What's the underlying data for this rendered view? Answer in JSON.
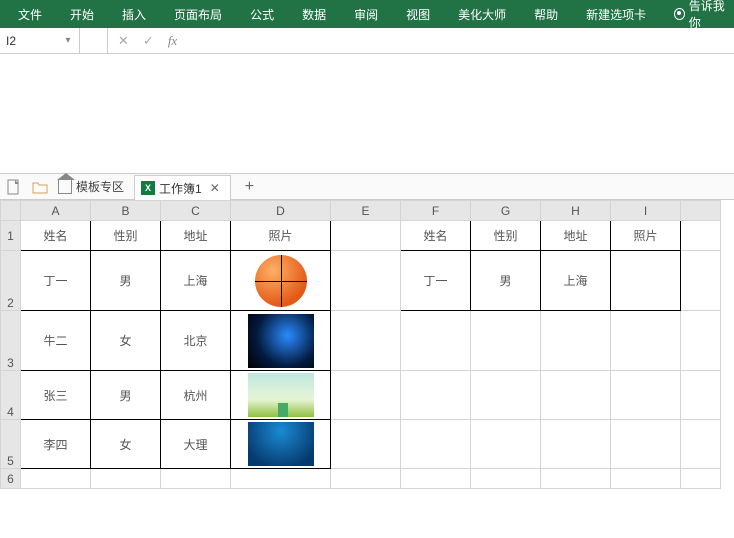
{
  "ribbon": {
    "tabs": [
      "文件",
      "开始",
      "插入",
      "页面布局",
      "公式",
      "数据",
      "审阅",
      "视图",
      "美化大师",
      "帮助",
      "新建选项卡"
    ],
    "tellme": "告诉我你"
  },
  "fx": {
    "namebox": "I2",
    "cancel": "✕",
    "confirm": "✓",
    "fx": "fx",
    "value": ""
  },
  "tabs": {
    "template_area": "模板专区",
    "sheet_name": "工作簿1",
    "close": "✕",
    "add": "+"
  },
  "columns": [
    "A",
    "B",
    "C",
    "D",
    "E",
    "F",
    "G",
    "H",
    "I"
  ],
  "rows": [
    "1",
    "2",
    "3",
    "4",
    "5",
    "6"
  ],
  "left_headers": {
    "name": "姓名",
    "gender": "性别",
    "addr": "地址",
    "photo": "照片"
  },
  "right_headers": {
    "name": "姓名",
    "gender": "性别",
    "addr": "地址",
    "photo": "照片"
  },
  "left_data": [
    {
      "name": "丁一",
      "gender": "男",
      "addr": "上海",
      "photo": "basketball"
    },
    {
      "name": "牛二",
      "gender": "女",
      "addr": "北京",
      "photo": "space"
    },
    {
      "name": "张三",
      "gender": "男",
      "addr": "杭州",
      "photo": "sky"
    },
    {
      "name": "李四",
      "gender": "女",
      "addr": "大理",
      "photo": "ocean"
    }
  ],
  "right_data": [
    {
      "name": "丁一",
      "gender": "男",
      "addr": "上海",
      "photo": ""
    }
  ]
}
